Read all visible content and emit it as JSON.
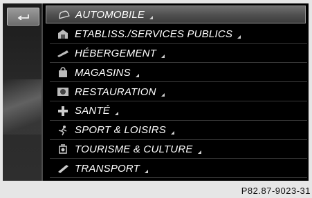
{
  "back_button": {
    "icon": "back-arrow-icon"
  },
  "menu": {
    "items": [
      {
        "label": "AUTOMOBILE",
        "icon": "car-icon",
        "selected": true
      },
      {
        "label": "ETABLISS./SERVICES PUBLICS",
        "icon": "building-icon"
      },
      {
        "label": "HÉBERGEMENT",
        "icon": "bed-icon"
      },
      {
        "label": "MAGASINS",
        "icon": "shopping-icon"
      },
      {
        "label": "RESTAURATION",
        "icon": "restaurant-icon"
      },
      {
        "label": "SANTÉ",
        "icon": "medical-cross-icon"
      },
      {
        "label": "SPORT & LOISIRS",
        "icon": "sport-icon"
      },
      {
        "label": "TOURISME & CULTURE",
        "icon": "tourism-icon"
      },
      {
        "label": "TRANSPORT",
        "icon": "transport-icon"
      }
    ]
  },
  "caption": "P82.87-9023-31",
  "colors": {
    "screen_bg": "#000000",
    "text": "#ffffff",
    "page_bg": "#e6e6e6",
    "highlight": "#5a5a5a"
  }
}
